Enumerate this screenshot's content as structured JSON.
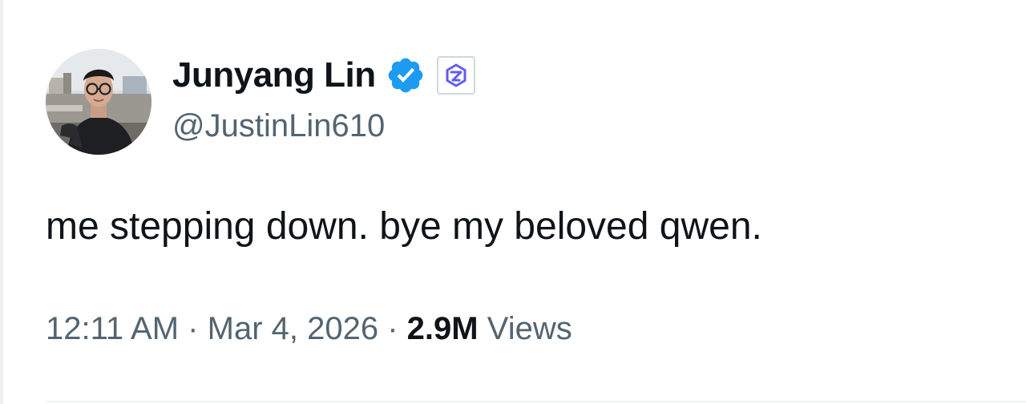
{
  "author": {
    "display_name": "Junyang Lin",
    "handle": "@JustinLin610",
    "verified_icon": "blue-verified-checkmark-icon",
    "affiliate_badge_icon": "qwen-logo-icon"
  },
  "tweet": {
    "text": "me stepping down. bye my beloved qwen."
  },
  "meta": {
    "time": "12:11 AM",
    "separator_1": "·",
    "date": "Mar 4, 2026",
    "separator_2": "·",
    "views_count": "2.9M",
    "views_label": "Views"
  },
  "colors": {
    "verified": "#1d9bf0",
    "text_primary": "#0f1419",
    "text_secondary": "#536471",
    "qwen_badge": "#615ced"
  }
}
